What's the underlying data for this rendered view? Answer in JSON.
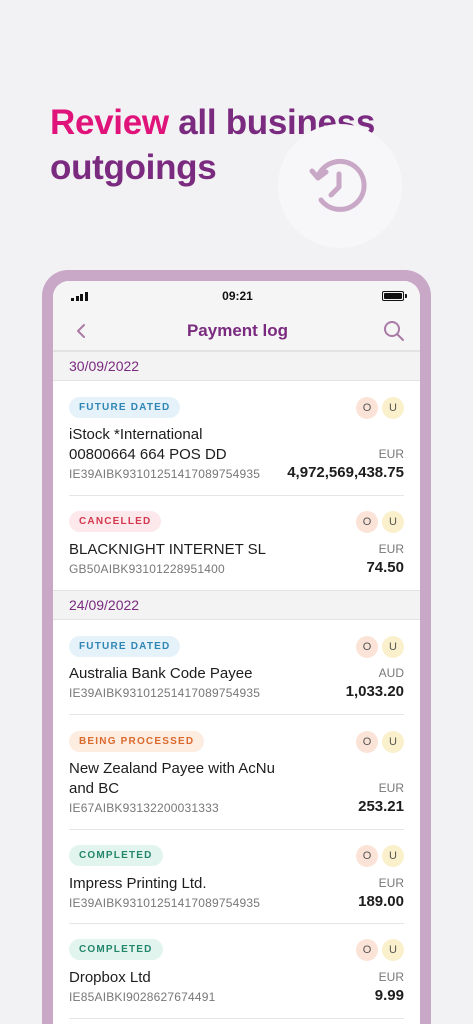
{
  "headline": {
    "accent": "Review",
    "rest_line1": " all business",
    "line2": "outgoings"
  },
  "status": {
    "time": "09:21"
  },
  "nav": {
    "title": "Payment log"
  },
  "ou_labels": {
    "o": "O",
    "u": "U"
  },
  "groups": [
    {
      "date": "30/09/2022",
      "items": [
        {
          "status": "FUTURE DATED",
          "payee": "iStock *International 00800664 664 POS DD",
          "iban": "IE39AIBK93101251417089754935",
          "currency": "EUR",
          "amount": "4,972,569,438.75"
        },
        {
          "status": "CANCELLED",
          "payee": "BLACKNIGHT INTERNET SL",
          "iban": "GB50AIBK93101228951400",
          "currency": "EUR",
          "amount": "74.50"
        }
      ]
    },
    {
      "date": "24/09/2022",
      "items": [
        {
          "status": "FUTURE DATED",
          "payee": "Australia Bank Code Payee",
          "iban": "IE39AIBK93101251417089754935",
          "currency": "AUD",
          "amount": "1,033.20"
        },
        {
          "status": "BEING PROCESSED",
          "payee": "New Zealand Payee with AcNu and BC",
          "iban": "IE67AIBK93132200031333",
          "currency": "EUR",
          "amount": "253.21"
        },
        {
          "status": "COMPLETED",
          "payee": "Impress Printing Ltd.",
          "iban": "IE39AIBK93101251417089754935",
          "currency": "EUR",
          "amount": "189.00"
        },
        {
          "status": "COMPLETED",
          "payee": "Dropbox Ltd",
          "iban": "IE85AIBKI9028627674491",
          "currency": "EUR",
          "amount": "9.99"
        }
      ]
    }
  ],
  "colors": {
    "brand_purple": "#7a2a7f",
    "accent_pink": "#e0137a",
    "frame": "#c9a7c7"
  },
  "icons": {
    "hero": "history-clock-icon",
    "back": "chevron-left-icon",
    "search": "search-icon"
  }
}
